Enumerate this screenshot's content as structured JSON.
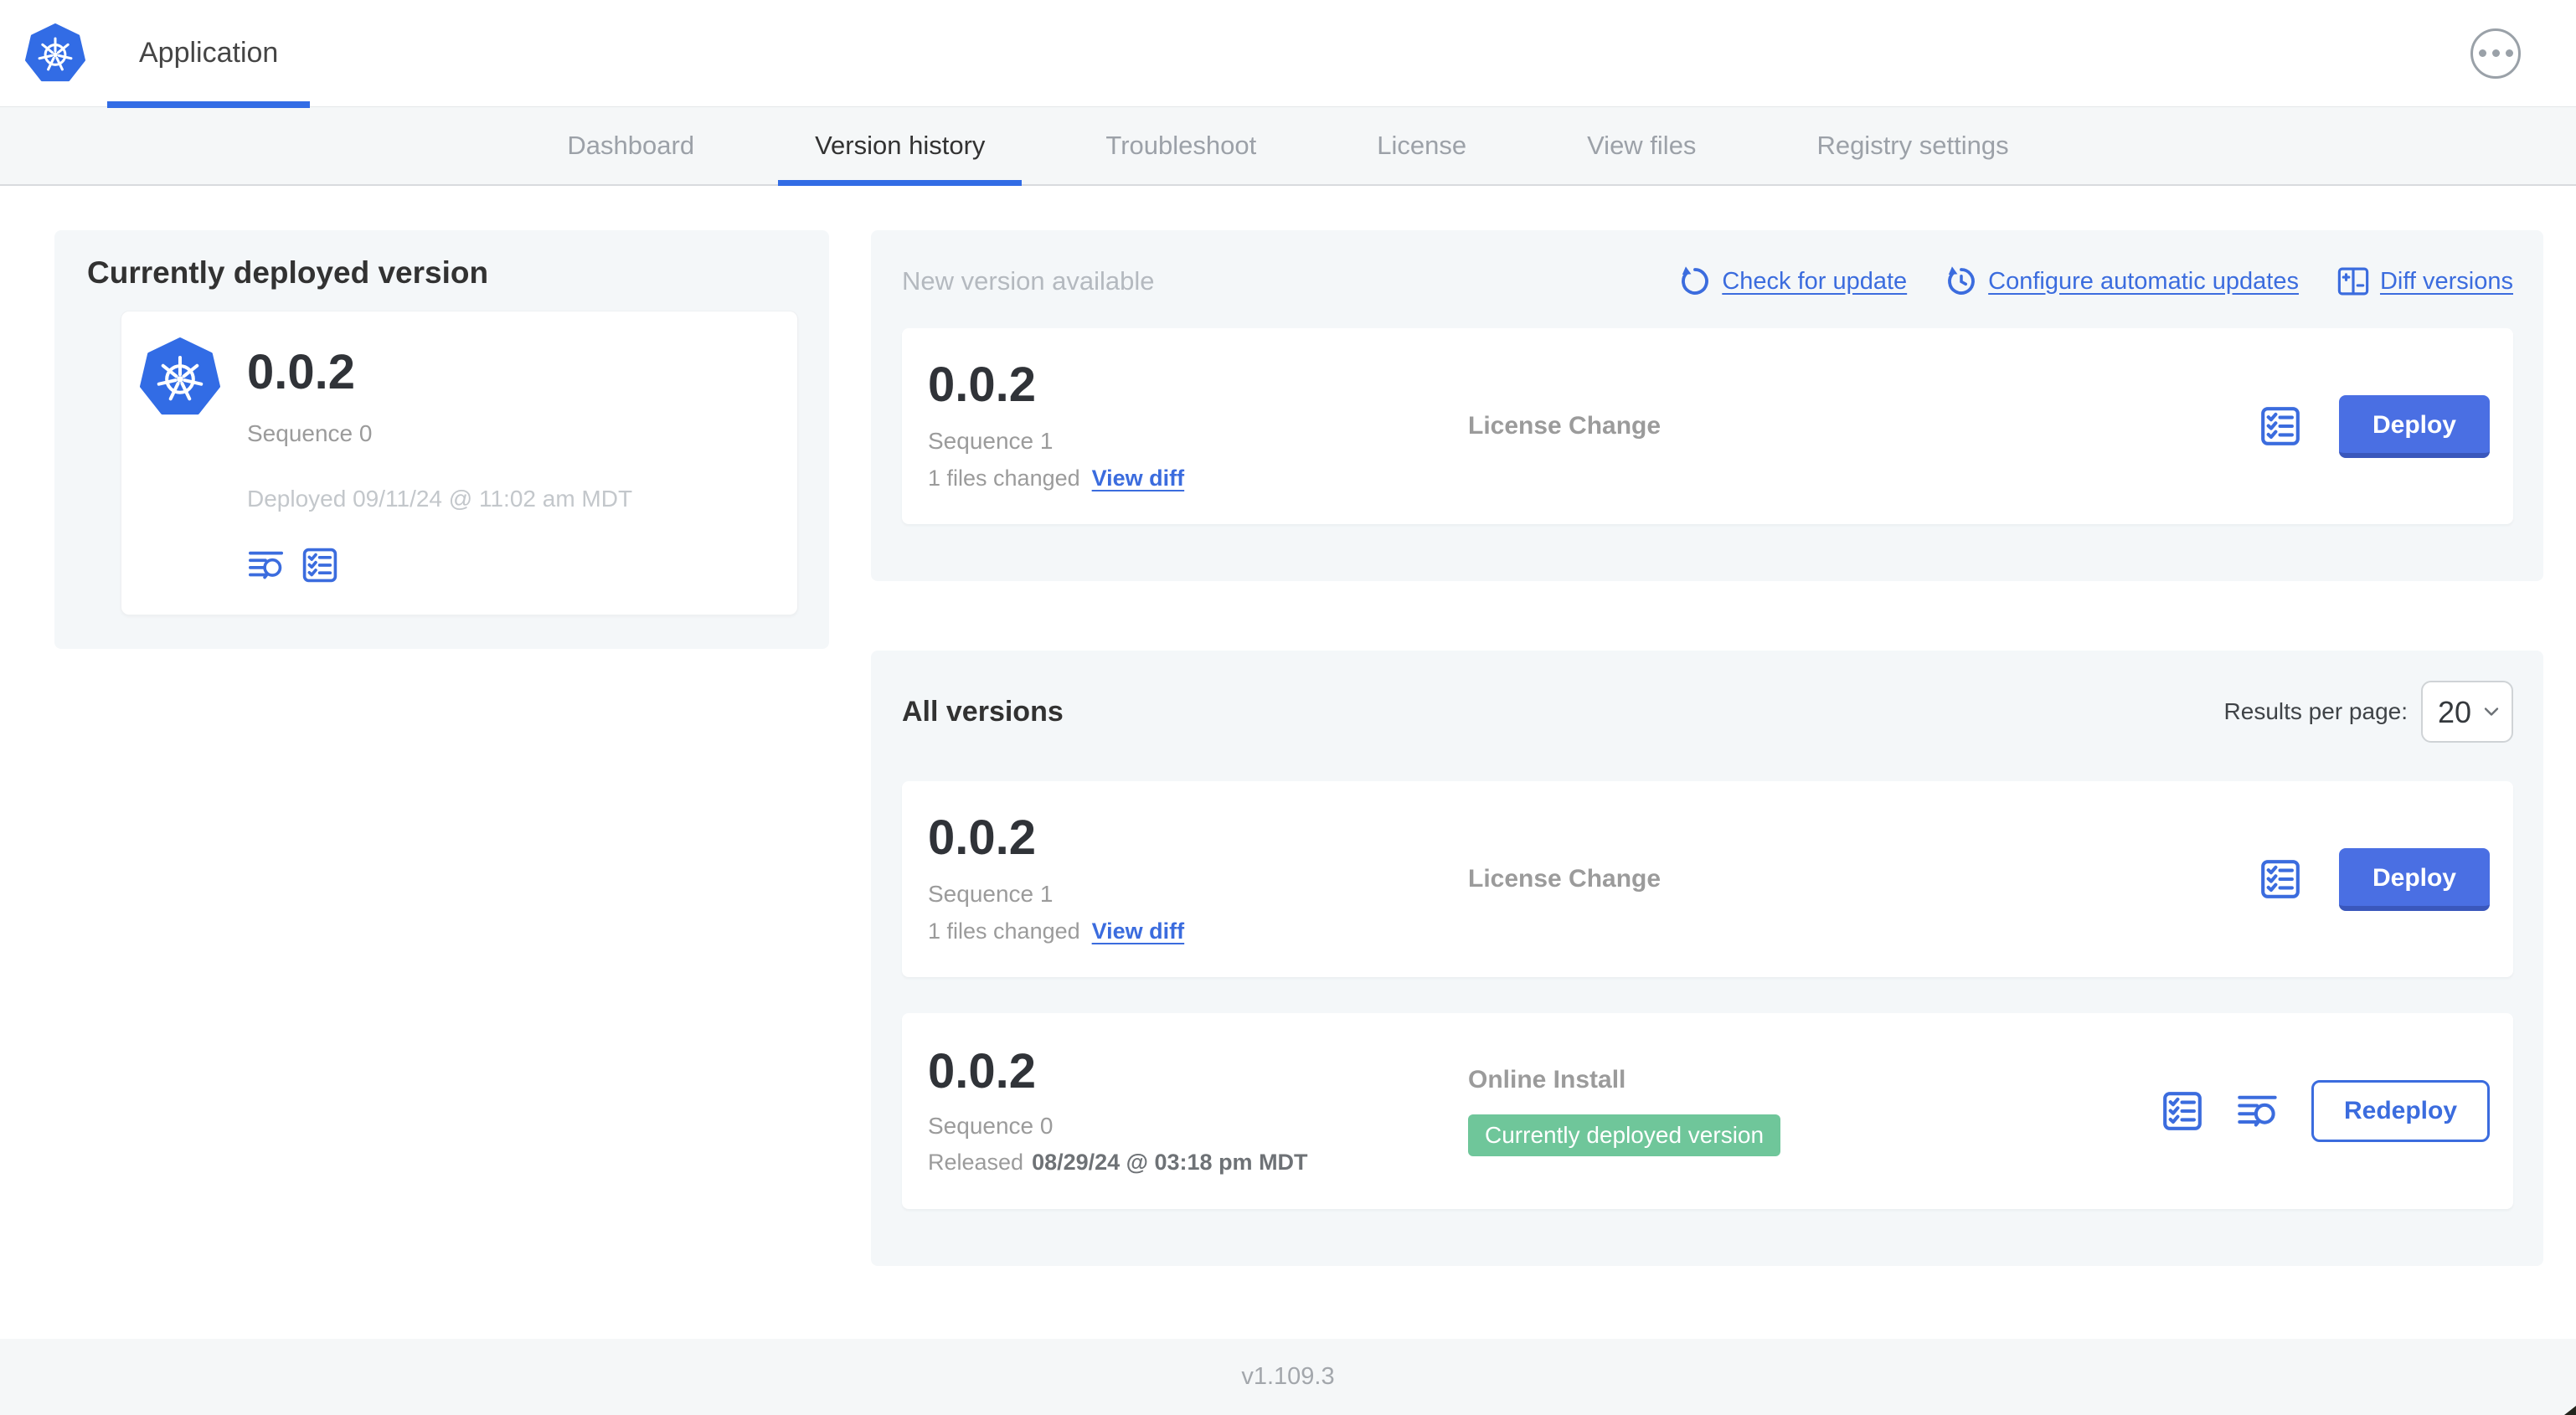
{
  "colors": {
    "primary_blue": "#3B6CDE",
    "button_blue": "#4A6FE3",
    "button_blue_dark": "#3A57BC",
    "k8s_blue": "#326CE5",
    "badge_green": "#6FC69A",
    "panel_bg": "#F4F7F9",
    "subnav_bg": "#F5F7F8",
    "text_dark": "#323232",
    "text_gray": "#9B9B9B",
    "text_light": "#C3C7CB"
  },
  "header": {
    "app_title": "Application"
  },
  "nav": {
    "tabs": [
      {
        "label": "Dashboard",
        "active": false
      },
      {
        "label": "Version history",
        "active": true
      },
      {
        "label": "Troubleshoot",
        "active": false
      },
      {
        "label": "License",
        "active": false
      },
      {
        "label": "View files",
        "active": false
      },
      {
        "label": "Registry settings",
        "active": false
      }
    ]
  },
  "current_version": {
    "panel_title": "Currently deployed version",
    "version": "0.0.2",
    "sequence": "Sequence 0",
    "deployed": "Deployed 09/11/24 @ 11:02 am MDT"
  },
  "new_version": {
    "panel_title": "New version available",
    "actions": {
      "check_for_update": "Check for update",
      "configure_automatic_updates": "Configure automatic updates",
      "diff_versions": "Diff versions"
    },
    "card": {
      "version": "0.0.2",
      "sequence": "Sequence 1",
      "files_changed": "1 files changed",
      "view_diff": "View diff",
      "source": "License Change",
      "deploy_label": "Deploy"
    }
  },
  "all_versions": {
    "panel_title": "All versions",
    "results_per_page_label": "Results per page:",
    "page_size": "20",
    "rows": [
      {
        "version": "0.0.2",
        "sequence": "Sequence 1",
        "files_changed": "1 files changed",
        "view_diff": "View diff",
        "source": "License Change",
        "deploy_label": "Deploy"
      },
      {
        "version": "0.0.2",
        "sequence": "Sequence 0",
        "released_prefix": "Released",
        "released_date": "08/29/24 @ 03:18 pm MDT",
        "source": "Online Install",
        "status_badge": "Currently deployed version",
        "redeploy_label": "Redeploy"
      }
    ]
  },
  "footer": {
    "console_version": "v1.109.3"
  },
  "icons": {
    "app_logo": "kubernetes-logo",
    "menu": "ellipsis-icon",
    "check_for_update": "refresh-icon",
    "configure_automatic_updates": "scheduled-update-icon",
    "diff_versions": "diff-icon",
    "preflight_checks": "checklist-icon",
    "view_logs": "logs-icon",
    "page_size": "chevron-down-icon"
  }
}
